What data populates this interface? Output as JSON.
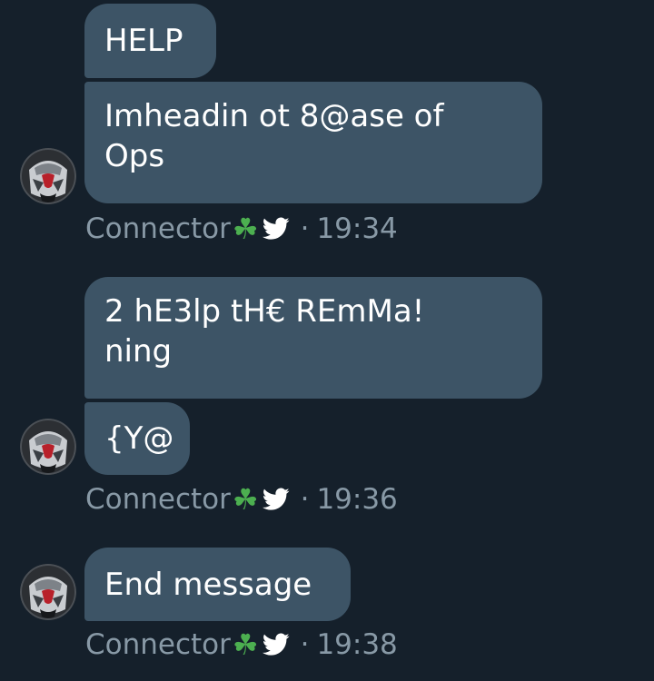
{
  "messages": [
    {
      "text": "HELP"
    },
    {
      "lines": [
        "Imheadin ot 8@ase of",
        "Ops"
      ]
    },
    {
      "lines": [
        "2 hE3lp tH€ REmMa!",
        "ning"
      ]
    },
    {
      "text": "{Y@"
    },
    {
      "text": "End message"
    }
  ],
  "groups": [
    {
      "sender": "Connector",
      "badge": "☘",
      "time": "19:34"
    },
    {
      "sender": "Connector",
      "badge": "☘",
      "time": "19:36"
    },
    {
      "sender": "Connector",
      "badge": "☘",
      "time": "19:38"
    }
  ],
  "meta_separator": "·",
  "icons": {
    "badge": "shamrock-icon",
    "platform": "twitter-bird-icon"
  },
  "colors": {
    "background": "#15202b",
    "bubble": "#3d5466",
    "message_text": "#ffffff",
    "meta_text": "#8899a6",
    "shamrock": "#4caf50",
    "twitter_bird": "#ffffff"
  }
}
